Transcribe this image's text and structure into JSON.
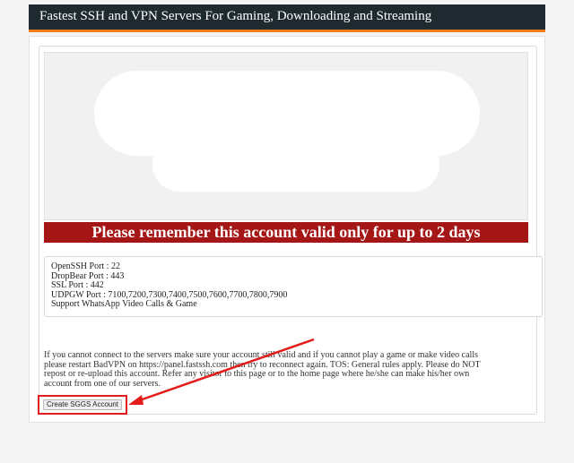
{
  "header": {
    "title": "Fastest SSH and VPN Servers For Gaming, Downloading and Streaming"
  },
  "banner": {
    "text": "Please remember this account valid only for up to 2 days"
  },
  "ports": {
    "lines": [
      "OpenSSH Port : 22",
      "DropBear Port : 443",
      "SSL Port : 442",
      "UDPGW Port : 7100,7200,7300,7400,7500,7600,7700,7800,7900",
      "Support WhatsApp Video Calls & Game"
    ]
  },
  "notice": {
    "lines": [
      "If you cannot connect to the servers make sure your account still valid and if you cannot play a game or make video calls",
      "please restart BadVPN on https://panel.fastssh.com then try to reconnect again. TOS: General rules apply. Please do NOT",
      "repost or re-upload this account. Refer any visitor to this page or to the home page where he/she can make his/her own",
      "account from one of our servers."
    ]
  },
  "actions": {
    "create_label": "Create SGGS Account"
  },
  "colors": {
    "header_bg": "#1f2a30",
    "header_accent": "#f07c1b",
    "banner_bg": "#a51616",
    "annotation_red": "#e21b1b"
  }
}
